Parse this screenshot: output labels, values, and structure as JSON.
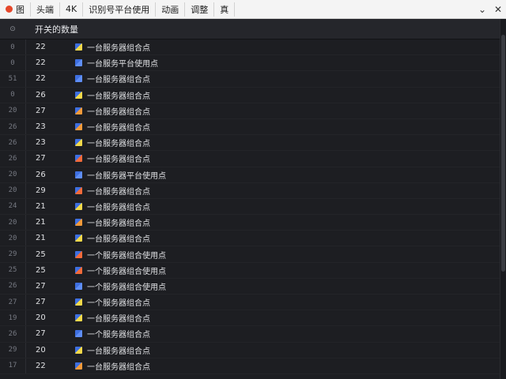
{
  "toolbar": {
    "items": [
      "图",
      "头端",
      "4K",
      "识别号平台使用",
      "动画",
      "调整",
      "真"
    ],
    "window_buttons": [
      "⌄",
      "✕"
    ]
  },
  "header": {
    "title": "开关的数量"
  },
  "rows": [
    {
      "idx": "0",
      "num": "22",
      "icon_color": "#f2d94a",
      "label": "一台服务器组合点"
    },
    {
      "idx": "0",
      "num": "22",
      "icon_color": "#5f8ef5",
      "label": "一台服务平台使用点"
    },
    {
      "idx": "51",
      "num": "22",
      "icon_color": "#5f8ef5",
      "label": "一台服务器组合点"
    },
    {
      "idx": "0",
      "num": "26",
      "icon_color": "#f2d94a",
      "label": "一台服务器组合点"
    },
    {
      "idx": "20",
      "num": "27",
      "icon_color": "#f29a3a",
      "label": "一台服务器组合点"
    },
    {
      "idx": "26",
      "num": "23",
      "icon_color": "#f29a3a",
      "label": "一台服务器组合点"
    },
    {
      "idx": "26",
      "num": "23",
      "icon_color": "#f2d94a",
      "label": "一台服务器组合点"
    },
    {
      "idx": "26",
      "num": "27",
      "icon_color": "#f26a3a",
      "label": "一台服务器组合点"
    },
    {
      "idx": "20",
      "num": "26",
      "icon_color": "#5f8ef5",
      "label": "一台服务器平台使用点"
    },
    {
      "idx": "20",
      "num": "29",
      "icon_color": "#f26a3a",
      "label": "一台服务器组合点"
    },
    {
      "idx": "24",
      "num": "21",
      "icon_color": "#f2d94a",
      "label": "一台服务器组合点"
    },
    {
      "idx": "20",
      "num": "21",
      "icon_color": "#f29a3a",
      "label": "一台服务器组合点"
    },
    {
      "idx": "20",
      "num": "21",
      "icon_color": "#f2d94a",
      "label": "一台服务器组合点"
    },
    {
      "idx": "29",
      "num": "25",
      "icon_color": "#f26a3a",
      "label": "一个服务器组合使用点"
    },
    {
      "idx": "25",
      "num": "25",
      "icon_color": "#f26a3a",
      "label": "一个服务器组合使用点"
    },
    {
      "idx": "26",
      "num": "27",
      "icon_color": "#5f8ef5",
      "label": "一个服务器组合使用点"
    },
    {
      "idx": "27",
      "num": "27",
      "icon_color": "#f2d94a",
      "label": "一个服务器组合点"
    },
    {
      "idx": "19",
      "num": "20",
      "icon_color": "#f2d94a",
      "label": "一台服务器组合点"
    },
    {
      "idx": "26",
      "num": "27",
      "icon_color": "#5f8ef5",
      "label": "一个服务器组合点"
    },
    {
      "idx": "29",
      "num": "20",
      "icon_color": "#f2d94a",
      "label": "一台服务器组合点"
    },
    {
      "idx": "17",
      "num": "22",
      "icon_color": "#f29a3a",
      "label": "一台服务器组合点"
    }
  ],
  "colors": {
    "record_dot": "#e5472a",
    "background": "#1d1e22",
    "toolbar": "#f4f4f4"
  }
}
